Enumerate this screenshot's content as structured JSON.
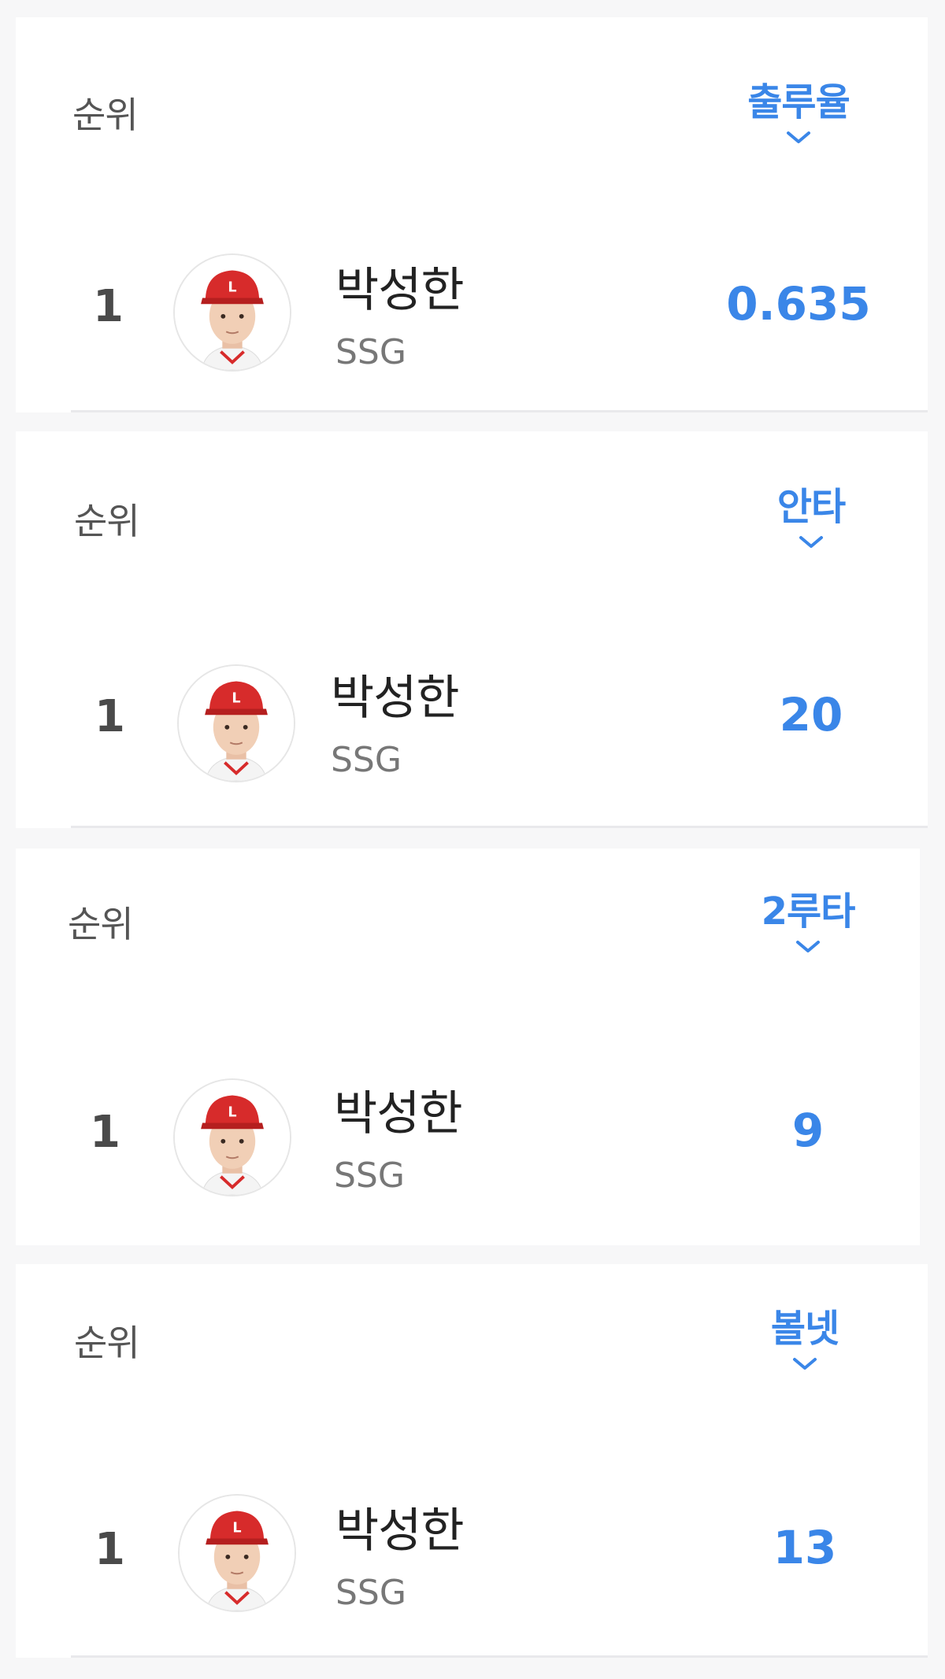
{
  "colors": {
    "accent": "#3a86e8",
    "rank_text": "#4a4a4a",
    "label_text": "#555555",
    "team_text": "#777777",
    "cap_red": "#d72b2b"
  },
  "icons": {
    "sort": "chevron-down-icon",
    "avatar": "player-photo"
  },
  "leaderboards": [
    {
      "rank_header": "순위",
      "stat_label": "출루율",
      "rows": [
        {
          "rank": "1",
          "player": "박성한",
          "team": "SSG",
          "value": "0.635"
        }
      ]
    },
    {
      "rank_header": "순위",
      "stat_label": "안타",
      "rows": [
        {
          "rank": "1",
          "player": "박성한",
          "team": "SSG",
          "value": "20"
        }
      ]
    },
    {
      "rank_header": "순위",
      "stat_label": "2루타",
      "rows": [
        {
          "rank": "1",
          "player": "박성한",
          "team": "SSG",
          "value": "9"
        }
      ]
    },
    {
      "rank_header": "순위",
      "stat_label": "볼넷",
      "rows": [
        {
          "rank": "1",
          "player": "박성한",
          "team": "SSG",
          "value": "13"
        }
      ]
    }
  ]
}
